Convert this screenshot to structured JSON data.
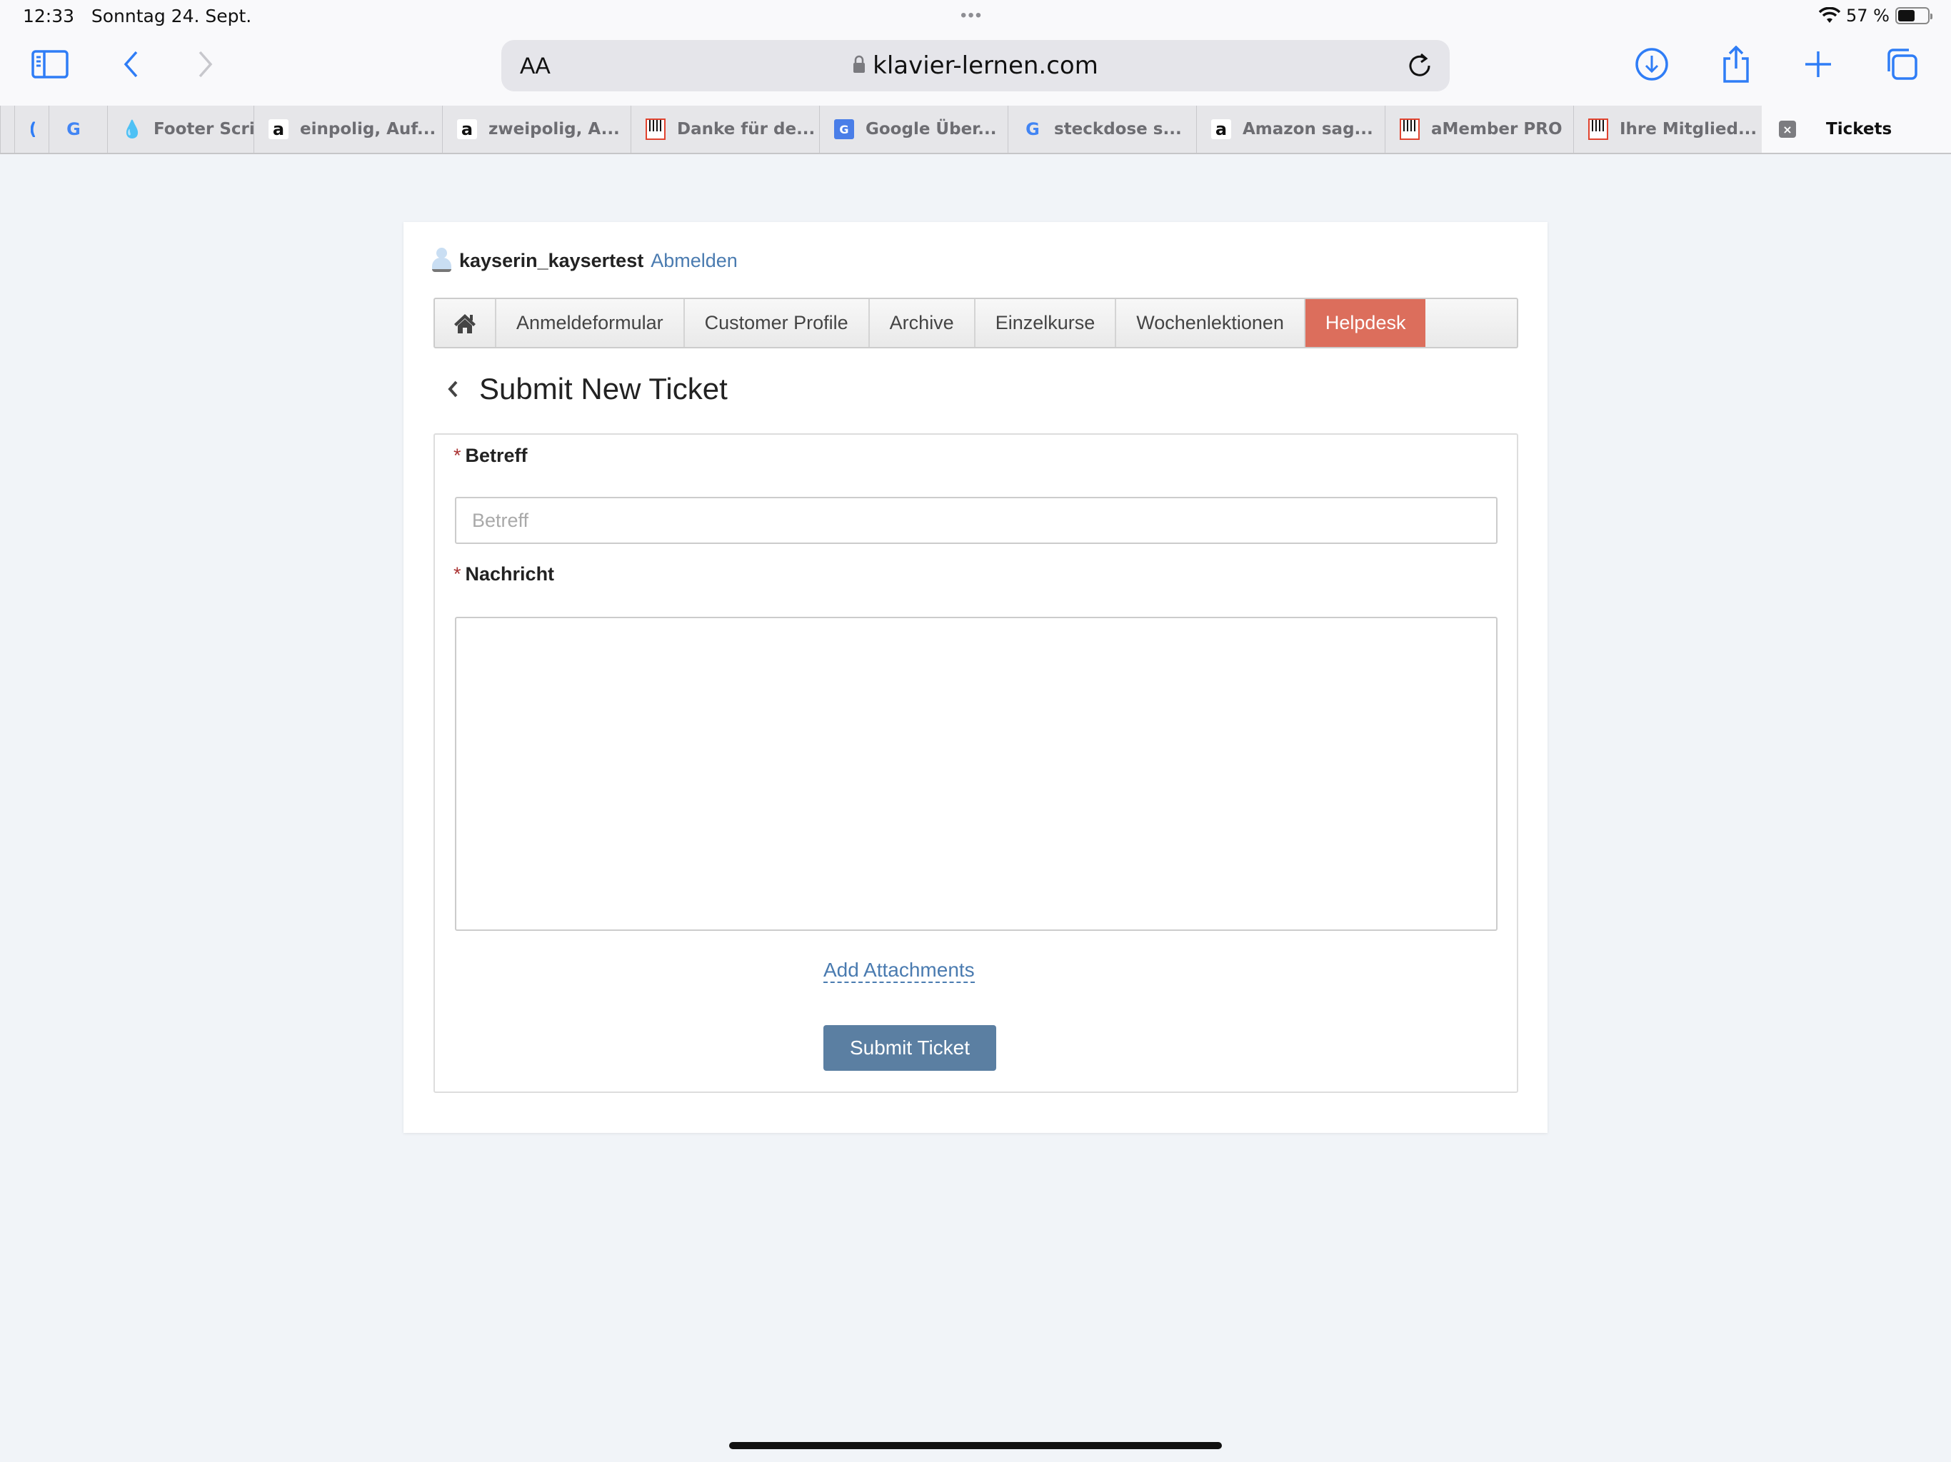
{
  "status_bar": {
    "time": "12:33",
    "date": "Sonntag 24. Sept.",
    "battery_text": "57 %",
    "battery_level": 0.57,
    "icons": [
      "wifi-icon",
      "battery-icon"
    ]
  },
  "toolbar": {
    "sidebar_icon": "sidebar-icon",
    "back_icon": "chevron-left-icon",
    "forward_icon": "chevron-right-icon",
    "text_size_label": "AA",
    "url": "klavier-lernen.com",
    "reload_icon": "reload-icon",
    "download_icon": "download-icon",
    "share_icon": "share-icon",
    "new_tab_icon": "plus-icon",
    "tabs_overview_icon": "tabs-icon"
  },
  "tabs": [
    {
      "label": "",
      "favicon": "partial"
    },
    {
      "label": "",
      "favicon": "google"
    },
    {
      "label": "Footer Scri",
      "favicon": "drupal"
    },
    {
      "label": "einpolig, Auf...",
      "favicon": "amazon"
    },
    {
      "label": "zweipolig, A...",
      "favicon": "amazon"
    },
    {
      "label": "Danke für de...",
      "favicon": "piano"
    },
    {
      "label": "Google Über...",
      "favicon": "google-translate"
    },
    {
      "label": "steckdose s...",
      "favicon": "google"
    },
    {
      "label": "Amazon sag...",
      "favicon": "amazon"
    },
    {
      "label": "aMember PRO",
      "favicon": "piano"
    },
    {
      "label": "Ihre Mitglied...",
      "favicon": "piano"
    },
    {
      "label": "Tickets",
      "favicon": "close",
      "active": true
    }
  ],
  "user": {
    "username": "kayserin_kaysertest",
    "logout_label": "Abmelden"
  },
  "nav": {
    "items": [
      {
        "label": "Anmeldeformular"
      },
      {
        "label": "Customer Profile"
      },
      {
        "label": "Archive"
      },
      {
        "label": "Einzelkurse"
      },
      {
        "label": "Wochenlektionen"
      },
      {
        "label": "Helpdesk",
        "active": true
      }
    ],
    "active_color": "#dc6e5c"
  },
  "page": {
    "title": "Submit New Ticket"
  },
  "form": {
    "required_mark": "*",
    "subject_label": "Betreff",
    "subject_placeholder": "Betreff",
    "subject_value": "",
    "message_label": "Nachricht",
    "message_value": "",
    "add_attachments_label": "Add Attachments",
    "submit_label": "Submit Ticket",
    "submit_color": "#5b7fa2"
  }
}
